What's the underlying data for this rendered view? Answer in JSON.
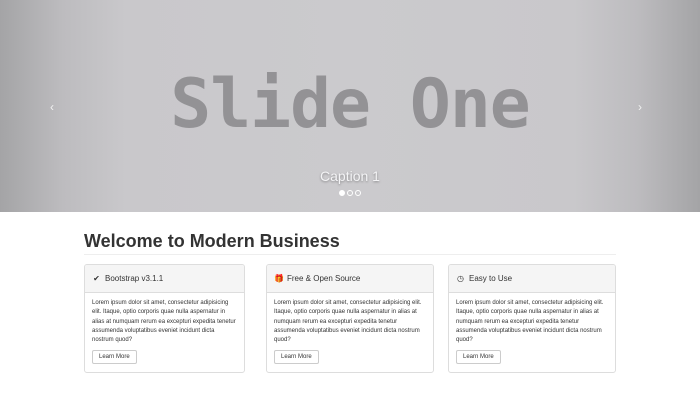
{
  "carousel": {
    "slide_title": "Slide One",
    "caption": "Caption 1",
    "indicator_count": 3,
    "active_index": 0,
    "prev_glyph": "‹",
    "next_glyph": "›"
  },
  "main": {
    "heading": "Welcome to Modern Business",
    "panels": [
      {
        "icon": "check-icon",
        "icon_glyph": "✔",
        "title": "Bootstrap v3.1.1",
        "body": "Lorem ipsum dolor sit amet, consectetur adipisicing elit. Itaque, optio corporis quae nulla aspernatur in alias at numquam rerum ea excepturi expedita tenetur assumenda voluptatibus eveniet incidunt dicta nostrum quod?",
        "button": "Learn More"
      },
      {
        "icon": "gift-icon",
        "icon_glyph": "🎁",
        "title": "Free & Open Source",
        "body": "Lorem ipsum dolor sit amet, consectetur adipisicing elit. Itaque, optio corporis quae nulla aspernatur in alias at numquam rerum ea excepturi expedita tenetur assumenda voluptatibus eveniet incidunt dicta nostrum quod?",
        "button": "Learn More"
      },
      {
        "icon": "compass-icon",
        "icon_glyph": "◷",
        "title": "Easy to Use",
        "body": "Lorem ipsum dolor sit amet, consectetur adipisicing elit. Itaque, optio corporis quae nulla aspernatur in alias at numquam rerum ea excepturi expedita tenetur assumenda voluptatibus eveniet incidunt dicta nostrum quod?",
        "button": "Learn More"
      }
    ]
  }
}
